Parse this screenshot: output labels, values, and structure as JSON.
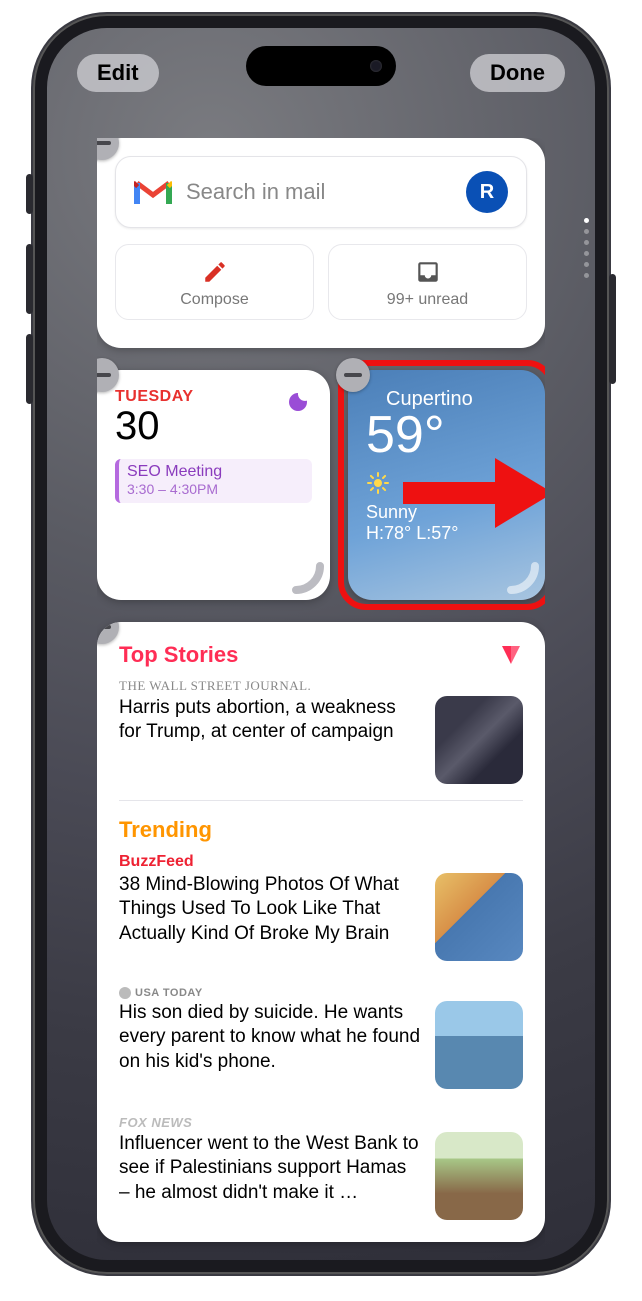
{
  "topbar": {
    "edit": "Edit",
    "done": "Done"
  },
  "gmail": {
    "search_placeholder": "Search in mail",
    "avatar_initial": "R",
    "compose_label": "Compose",
    "unread_label": "99+ unread"
  },
  "calendar": {
    "day_label": "TUESDAY",
    "date": "30",
    "event_title": "SEO Meeting",
    "event_time": "3:30 – 4:30PM"
  },
  "weather": {
    "location": "Cupertino",
    "temp": "59°",
    "condition": "Sunny",
    "hilo": "H:78° L:57°"
  },
  "news": {
    "top_stories_label": "Top Stories",
    "trending_label": "Trending",
    "items": [
      {
        "source": "THE WALL STREET JOURNAL.",
        "source_class": "wsj",
        "title": "Harris puts abortion, a weakness for Trump, at center of campaign"
      },
      {
        "source": "BuzzFeed",
        "source_class": "bf",
        "title": "38 Mind-Blowing Photos Of What Things Used To Look Like That Actually Kind Of Broke My Brain"
      },
      {
        "source": "USA TODAY",
        "source_class": "usa",
        "title": "His son died by suicide. He wants every parent to know what he found on his kid's phone."
      },
      {
        "source": "FOX NEWS",
        "source_class": "fox",
        "title": "Influencer went to the West Bank to see if Palestinians support Hamas – he almost didn't make it …"
      }
    ]
  }
}
